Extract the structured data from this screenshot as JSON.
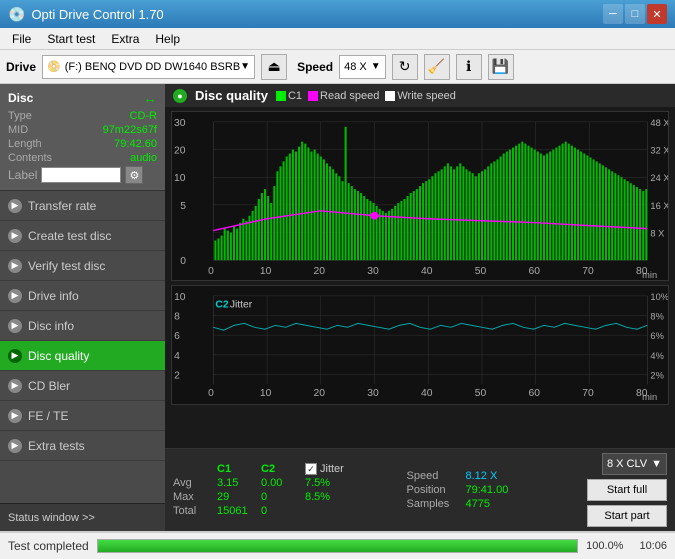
{
  "titlebar": {
    "title": "Opti Drive Control 1.70",
    "icon": "💿",
    "minimize": "─",
    "maximize": "□",
    "close": "✕"
  },
  "menu": {
    "items": [
      "File",
      "Start test",
      "Extra",
      "Help"
    ]
  },
  "drivebar": {
    "drive_label": "Drive",
    "drive_value": "(F:)  BENQ DVD DD DW1640 BSRB",
    "speed_label": "Speed",
    "speed_value": "48 X"
  },
  "disc": {
    "title": "Disc",
    "type_label": "Type",
    "type_value": "CD-R",
    "mid_label": "MID",
    "mid_value": "97m22s67f",
    "length_label": "Length",
    "length_value": "79:42.60",
    "contents_label": "Contents",
    "contents_value": "audio",
    "label_label": "Label"
  },
  "sidebar_items": [
    {
      "id": "transfer-rate",
      "label": "Transfer rate",
      "active": false
    },
    {
      "id": "create-test-disc",
      "label": "Create test disc",
      "active": false
    },
    {
      "id": "verify-test-disc",
      "label": "Verify test disc",
      "active": false
    },
    {
      "id": "drive-info",
      "label": "Drive info",
      "active": false
    },
    {
      "id": "disc-info",
      "label": "Disc info",
      "active": false
    },
    {
      "id": "disc-quality",
      "label": "Disc quality",
      "active": true
    },
    {
      "id": "cd-bler",
      "label": "CD Bler",
      "active": false
    },
    {
      "id": "fe-te",
      "label": "FE / TE",
      "active": false
    },
    {
      "id": "extra-tests",
      "label": "Extra tests",
      "active": false
    }
  ],
  "status_window_btn": "Status window >>",
  "disc_quality": {
    "title": "Disc quality",
    "legend": {
      "c1_label": "C1",
      "read_label": "Read speed",
      "write_label": "Write speed"
    }
  },
  "chart1": {
    "y_max": 30,
    "y_labels": [
      "30",
      "20",
      "10",
      "0"
    ],
    "x_labels": [
      "0",
      "10",
      "20",
      "30",
      "40",
      "50",
      "60",
      "70",
      "80"
    ],
    "right_labels": [
      "48 X",
      "32 X",
      "24 X",
      "16 X",
      "8 X"
    ],
    "min_unit": "min"
  },
  "chart2": {
    "title": "C2",
    "jitter_label": "Jitter",
    "y_max": 10,
    "y_labels": [
      "10",
      "8",
      "6",
      "4",
      "2"
    ],
    "x_labels": [
      "0",
      "10",
      "20",
      "30",
      "40",
      "50",
      "60",
      "70",
      "80"
    ],
    "right_labels": [
      "10%",
      "8%",
      "6%",
      "4%",
      "2%"
    ],
    "min_unit": "min"
  },
  "stats": {
    "c1_label": "C1",
    "c2_label": "C2",
    "jitter_label": "Jitter",
    "avg_label": "Avg",
    "avg_c1": "3.15",
    "avg_c2": "0.00",
    "avg_jitter": "7.5%",
    "max_label": "Max",
    "max_c1": "29",
    "max_c2": "0",
    "max_jitter": "8.5%",
    "total_label": "Total",
    "total_c1": "15061",
    "total_c2": "0",
    "speed_label": "Speed",
    "speed_value": "8.12 X",
    "position_label": "Position",
    "position_value": "79:41.00",
    "samples_label": "Samples",
    "samples_value": "4775"
  },
  "right_controls": {
    "speed_option": "8 X CLV",
    "start_full": "Start full",
    "start_part": "Start part"
  },
  "bottom": {
    "status": "Test completed",
    "progress": 100,
    "progress_pct": "100.0%",
    "time": "10:06"
  }
}
